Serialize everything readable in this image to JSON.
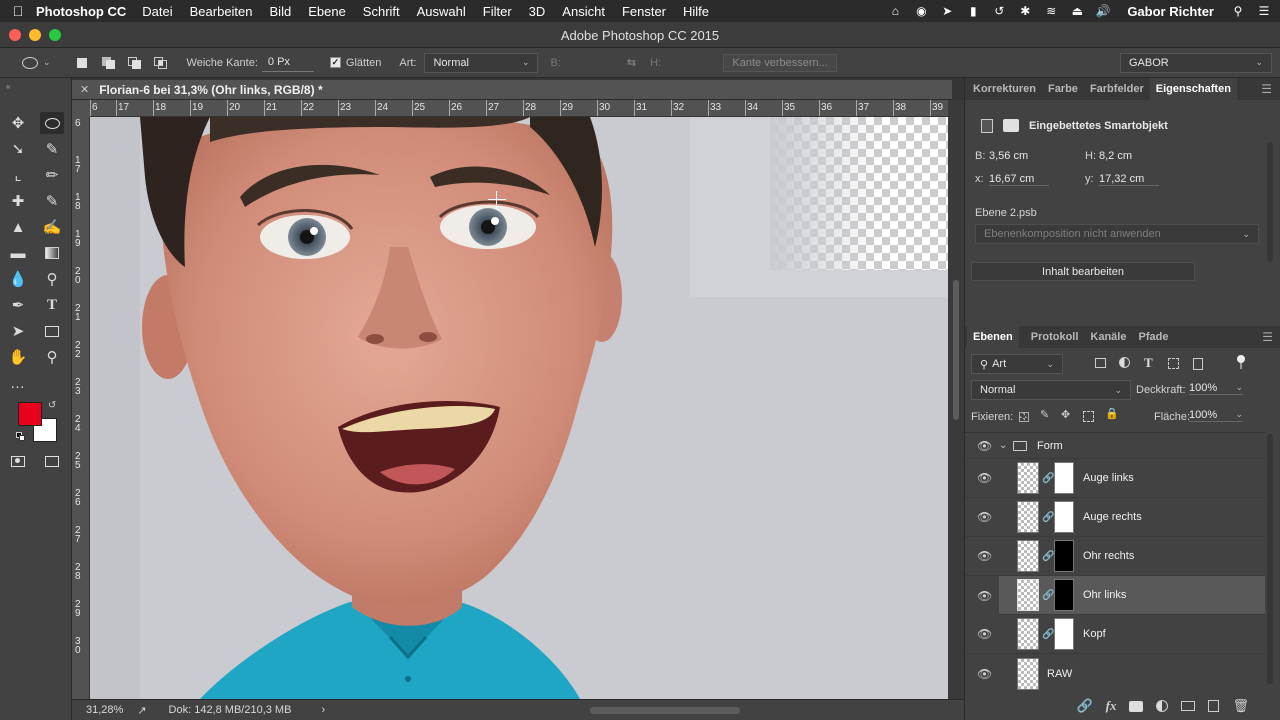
{
  "menubar": {
    "app_name": "Photoshop CC",
    "items": [
      "Datei",
      "Bearbeiten",
      "Bild",
      "Ebene",
      "Schrift",
      "Auswahl",
      "Filter",
      "3D",
      "Ansicht",
      "Fenster",
      "Hilfe"
    ],
    "user": "Gabor Richter"
  },
  "window": {
    "title": "Adobe Photoshop CC 2015"
  },
  "options": {
    "feather_label": "Weiche Kante:",
    "feather_value": "0 Px",
    "antialias_label": "Glätten",
    "style_label": "Art:",
    "style_value": "Normal",
    "width_label": "B:",
    "height_label": "H:",
    "refine_edge": "Kante verbessern...",
    "workspace": "GABOR"
  },
  "document": {
    "tab_title": "Florian-6 bei 31,3% (Ohr links, RGB/8) *",
    "ruler_top": [
      "6",
      "17",
      "18",
      "19",
      "20",
      "21",
      "22",
      "23",
      "24",
      "25",
      "26",
      "27",
      "28",
      "29",
      "30",
      "31",
      "32",
      "33",
      "34",
      "35",
      "36",
      "37",
      "38",
      "39"
    ],
    "ruler_left": [
      "6",
      "1\n7",
      "1\n8",
      "1\n9",
      "2\n0",
      "2\n1",
      "2\n2",
      "2\n3",
      "2\n4",
      "2\n5",
      "2\n6",
      "2\n7",
      "2\n8",
      "2\n9",
      "3\n0"
    ]
  },
  "status": {
    "zoom": "31,28%",
    "doc_info": "Dok: 142,8 MB/210,3 MB"
  },
  "properties_panel": {
    "tabs": [
      "Korrekturen",
      "Farbe",
      "Farbfelder",
      "Eigenschaften"
    ],
    "active_tab": "Eigenschaften",
    "type_label": "Eingebettetes Smartobjekt",
    "w_label": "B:",
    "w_value": "3,56 cm",
    "h_label": "H:",
    "h_value": "8,2 cm",
    "x_label": "x:",
    "x_value": "16,67 cm",
    "y_label": "y:",
    "y_value": "17,32 cm",
    "source_file": "Ebene 2.psb",
    "comp_select": "Ebenenkomposition nicht anwenden",
    "edit_button": "Inhalt bearbeiten"
  },
  "layers_panel": {
    "tabs": [
      "Ebenen",
      "Protokoll",
      "Kanäle",
      "Pfade"
    ],
    "active_tab": "Ebenen",
    "filter_kind": "Art",
    "blend_mode": "Normal",
    "opacity_label": "Deckkraft:",
    "opacity_value": "100%",
    "lock_label": "Fixieren:",
    "fill_label": "Fläche:",
    "fill_value": "100%",
    "group_name": "Form",
    "layers": [
      {
        "name": "Auge links",
        "mask": "white"
      },
      {
        "name": "Auge rechts",
        "mask": "white"
      },
      {
        "name": "Ohr rechts",
        "mask": "black"
      },
      {
        "name": "Ohr links",
        "mask": "black",
        "selected": true
      },
      {
        "name": "Kopf",
        "mask": "white"
      },
      {
        "name": "RAW",
        "mask": "none"
      }
    ]
  },
  "colors": {
    "foreground": "#e8001c",
    "background": "#ffffff",
    "shirt": "#1fa6c4",
    "backdrop": "#c9cbd1"
  }
}
